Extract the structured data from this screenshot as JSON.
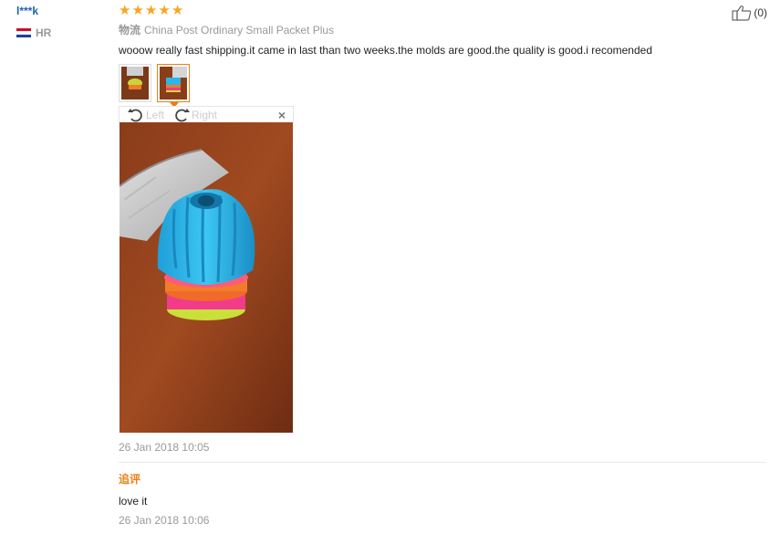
{
  "reviewer": {
    "name": "l***k",
    "country_code": "HR",
    "flag_colors": [
      "#c8102e",
      "#ffffff",
      "#1e3f9e"
    ]
  },
  "review": {
    "rating": 5,
    "logistics_label": "物流",
    "logistics_value": "China Post Ordinary Small Packet Plus",
    "text": "wooow really fast shipping.it came in last than two weeks.the molds are good.the quality is good.i recomended",
    "date": "26 Jan 2018 10:05"
  },
  "viewer": {
    "rotate_left_label": "Left",
    "rotate_right_label": "Right",
    "close_glyph": "×"
  },
  "additional": {
    "label": "追评",
    "text": "love it",
    "date": "26 Jan 2018 10:06"
  },
  "helpful": {
    "count_text": "(0)"
  },
  "colors": {
    "star": "#f5a623",
    "accent": "#e8811a",
    "link": "#1f5fb0"
  }
}
